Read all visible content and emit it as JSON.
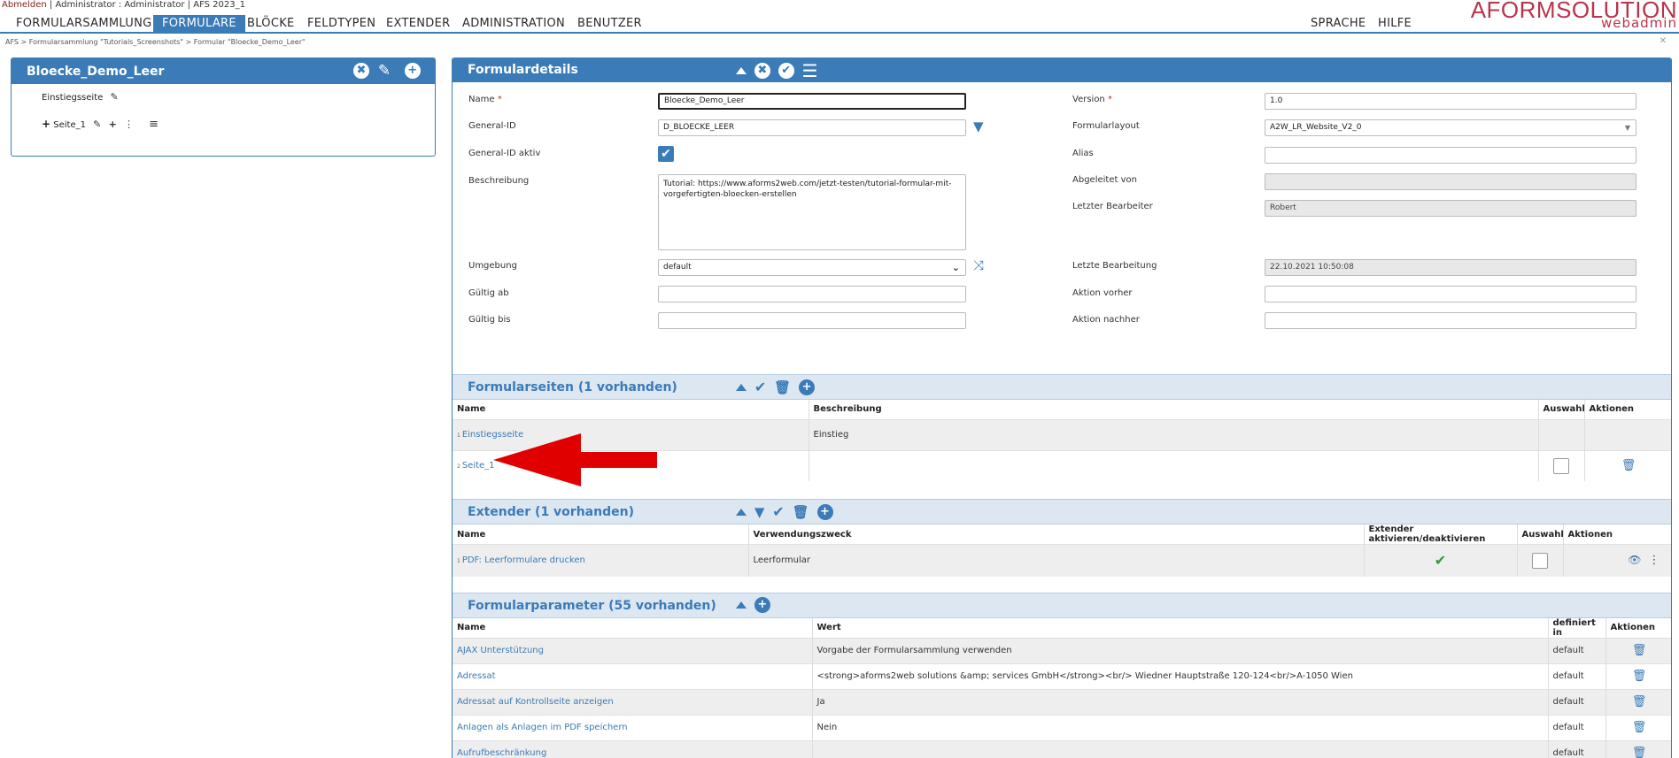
{
  "topbar": {
    "logout": "Abmelden",
    "user_info": "| Administrator : Administrator | AFS 2023_1"
  },
  "nav": {
    "items": [
      "FORMULARSAMMLUNG",
      "FORMULARE",
      "BLÖCKE",
      "FELDTYPEN",
      "EXTENDER",
      "ADMINISTRATION",
      "BENUTZER"
    ],
    "active": "FORMULARE",
    "right": [
      "SPRACHE",
      "HILFE"
    ]
  },
  "logo": {
    "brand": "AFORMSOLUTION",
    "sub": "webadmin"
  },
  "breadcrumb": "AFS > Formularsammlung \"Tutorials_Screenshots\" > Formular \"Bloecke_Demo_Leer\"",
  "left_panel": {
    "title": "Bloecke_Demo_Leer",
    "entry_page": "Einstiegsseite",
    "page": "Seite_1",
    "dots": "⋮",
    "menu": "≡"
  },
  "formdetails": {
    "title": "Formulardetails",
    "fields": {
      "name_label": "Name",
      "name_value": "Bloecke_Demo_Leer",
      "general_id_label": "General-ID",
      "general_id_value": "D_BLOECKE_LEER",
      "general_id_active_label": "General-ID aktiv",
      "description_label": "Beschreibung",
      "description_value": "Tutorial: https://www.aforms2web.com/jetzt-testen/tutorial-formular-mit-vorgefertigten-bloecken-erstellen",
      "environment_label": "Umgebung",
      "environment_value": "default",
      "valid_from_label": "Gültig ab",
      "valid_to_label": "Gültig bis",
      "version_label": "Version",
      "version_value": "1.0",
      "layout_label": "Formularlayout",
      "layout_value": "A2W_LR_Website_V2_0",
      "alias_label": "Alias",
      "derived_label": "Abgeleitet von",
      "last_editor_label": "Letzter Bearbeiter",
      "last_editor_value": "Robert",
      "last_edit_label": "Letzte Bearbeitung",
      "last_edit_value": "22.10.2021 10:50:08",
      "action_before_label": "Aktion vorher",
      "action_after_label": "Aktion nachher",
      "required_mark": "*"
    }
  },
  "pages": {
    "title": "Formularseiten (1 vorhanden)",
    "columns": [
      "Name",
      "Beschreibung",
      "Auswahl",
      "Aktionen"
    ],
    "rows": [
      {
        "idx": "1",
        "name": "Einstiegsseite",
        "description": "Einstieg"
      },
      {
        "idx": "2",
        "name": "Seite_1",
        "description": ""
      }
    ]
  },
  "extender": {
    "title": "Extender (1 vorhanden)",
    "columns": [
      "Name",
      "Verwendungszweck",
      "Extender aktivieren/deaktivieren",
      "Auswahl",
      "Aktionen"
    ],
    "rows": [
      {
        "idx": "1",
        "name": "PDF: Leerformulare drucken",
        "purpose": "Leerformular"
      }
    ]
  },
  "params": {
    "title": "Formularparameter (55 vorhanden)",
    "columns": [
      "Name",
      "Wert",
      "definiert in",
      "Aktionen"
    ],
    "rows": [
      {
        "name": "AJAX Unterstützung",
        "value": "Vorgabe der Formularsammlung verwenden",
        "defined": "default"
      },
      {
        "name": "Adressat",
        "value": "<strong>aforms2web solutions &amp; services GmbH</strong><br/> Wiedner Hauptstraße 120-124<br/>A-1050 Wien",
        "defined": "default"
      },
      {
        "name": "Adressat auf Kontrollseite anzeigen",
        "value": "Ja",
        "defined": "default"
      },
      {
        "name": "Anlagen als Anlagen im PDF speichern",
        "value": "Nein",
        "defined": "default"
      },
      {
        "name": "Aufrufbeschränkung",
        "value": "",
        "defined": "default"
      }
    ]
  },
  "icons": {
    "close": "✖",
    "edit": "✎",
    "plus": "+",
    "check": "✔",
    "list": "☰",
    "trash": "🗑",
    "filter": "▼",
    "shuffle": "⤨",
    "eye": "👁",
    "dots": "⋮",
    "closex": "✕"
  },
  "colors": {
    "accent": "#3a7bb8",
    "brand": "#b8344a",
    "arrow": "#e00000",
    "check": "#2e9a3c"
  }
}
